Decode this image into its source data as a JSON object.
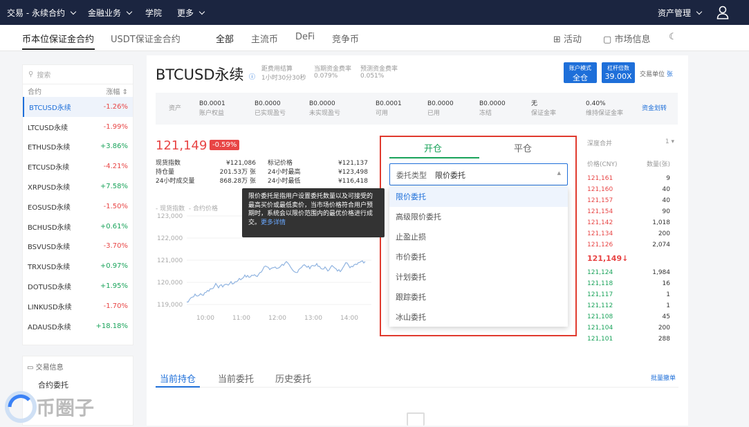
{
  "topnav": {
    "items": [
      {
        "label": "交易 - 永续合约"
      },
      {
        "label": "金融业务"
      },
      {
        "label": "学院"
      },
      {
        "label": "更多"
      }
    ],
    "asset_management": "资产管理"
  },
  "tabs": {
    "contract_tabs": [
      "币本位保证金合约",
      "USDT保证金合约"
    ],
    "filters": [
      "全部",
      "主流币",
      "DeFi",
      "竞争币"
    ],
    "activity": "活动",
    "market_info": "市场信息"
  },
  "sidebar": {
    "search_placeholder": "搜索",
    "header_contract": "合约",
    "header_change": "涨幅",
    "items": [
      {
        "name": "BTCUSD永续",
        "change": "-1.26%"
      },
      {
        "name": "LTCUSD永续",
        "change": "-1.99%"
      },
      {
        "name": "ETHUSD永续",
        "change": "+3.86%"
      },
      {
        "name": "ETCUSD永续",
        "change": "-4.21%"
      },
      {
        "name": "XRPUSD永续",
        "change": "+7.58%"
      },
      {
        "name": "EOSUSD永续",
        "change": "-1.50%"
      },
      {
        "name": "BCHUSD永续",
        "change": "+0.61%"
      },
      {
        "name": "BSVUSD永续",
        "change": "-3.70%"
      },
      {
        "name": "TRXUSD永续",
        "change": "+0.97%"
      },
      {
        "name": "DOTUSD永续",
        "change": "+1.95%"
      },
      {
        "name": "LINKUSD永续",
        "change": "-1.70%"
      },
      {
        "name": "ADAUSD永续",
        "change": "+18.18%"
      }
    ],
    "info_title": "交易信息",
    "info_link": "合约委托"
  },
  "header": {
    "title": "BTCUSD永续",
    "funding_label": "距费用结算",
    "funding_value": "1小时30分30秒",
    "current_rate_label": "当期资金费率",
    "current_rate_value": "0.079%",
    "predicted_rate_label": "预测资金费率",
    "predicted_rate_value": "0.051%",
    "account_mode_label": "账户模式",
    "account_mode_value": "全仓",
    "leverage_label": "杠杆倍数",
    "leverage_value": "39.00X",
    "unit_label": "交易单位",
    "unit_value": "张"
  },
  "assets": {
    "label": "资产",
    "items": [
      {
        "value": "B0.0001",
        "label": "账户权益"
      },
      {
        "value": "B0.0000",
        "label": "已实现盈亏"
      },
      {
        "value": "B0.0000",
        "label": "未实现盈亏"
      },
      {
        "value": "B0.0001",
        "label": "可用"
      },
      {
        "value": "B0.0000",
        "label": "已用"
      },
      {
        "value": "B0.0000",
        "label": "冻结"
      },
      {
        "value": "无",
        "label": "保证金率"
      },
      {
        "value": "0.40%",
        "label": "维持保证金率"
      }
    ],
    "transfer": "资金划转"
  },
  "ticker": {
    "price": "121,149",
    "change": "-0.59%",
    "stats_left": [
      {
        "label": "现货指数",
        "value": "¥121,086"
      },
      {
        "label": "持仓量",
        "value": "201.53万 张"
      },
      {
        "label": "24小时成交量",
        "value": "868.28万 张"
      }
    ],
    "stats_right": [
      {
        "label": "标记价格",
        "value": "¥121,137"
      },
      {
        "label": "24小时最高",
        "value": "¥123,498"
      },
      {
        "label": "24小时最低",
        "value": "¥116,418"
      }
    ]
  },
  "chart": {
    "legend_spot": "现货指数",
    "legend_contract": "合约价格",
    "yticks": [
      "123,000",
      "122,000",
      "121,000",
      "120,000",
      "119,000"
    ],
    "xticks": [
      "10:00",
      "11:00",
      "12:00",
      "13:00",
      "14:00"
    ],
    "line_color": "#8fb3e0"
  },
  "order": {
    "tab_open": "开仓",
    "tab_close": "平仓",
    "type_label": "委托类型",
    "type_value": "限价委托",
    "options": [
      "限价委托",
      "高级限价委托",
      "止盈止损",
      "市价委托",
      "计划委托",
      "跟踪委托",
      "冰山委托"
    ]
  },
  "tooltip": {
    "text": "限价委托是指用户设置委托数量以及可接受的最高买价或最低卖价，当市场价格符合用户预期时，系统会以限价范围内的最优价格进行成交。",
    "link": "更多详情"
  },
  "orderbook": {
    "depth_label": "深度合并",
    "depth_value": "1",
    "price_header": "价格(CNY)",
    "qty_header": "数量(张)",
    "asks": [
      {
        "price": "121,161",
        "qty": "9"
      },
      {
        "price": "121,160",
        "qty": "40"
      },
      {
        "price": "121,157",
        "qty": "40"
      },
      {
        "price": "121,154",
        "qty": "90"
      },
      {
        "price": "121,142",
        "qty": "1,018"
      },
      {
        "price": "121,134",
        "qty": "200"
      },
      {
        "price": "121,126",
        "qty": "2,074"
      }
    ],
    "last": "121,149↓",
    "bids": [
      {
        "price": "121,124",
        "qty": "1,984"
      },
      {
        "price": "121,118",
        "qty": "16"
      },
      {
        "price": "121,117",
        "qty": "1"
      },
      {
        "price": "121,112",
        "qty": "1"
      },
      {
        "price": "121,108",
        "qty": "45"
      },
      {
        "price": "121,104",
        "qty": "200"
      },
      {
        "price": "121,101",
        "qty": "288"
      }
    ]
  },
  "bottom": {
    "tabs": [
      "当前持仓",
      "当前委托",
      "历史委托"
    ],
    "batch_cancel": "批量撤单"
  },
  "watermark": {
    "text": "币圈子"
  }
}
